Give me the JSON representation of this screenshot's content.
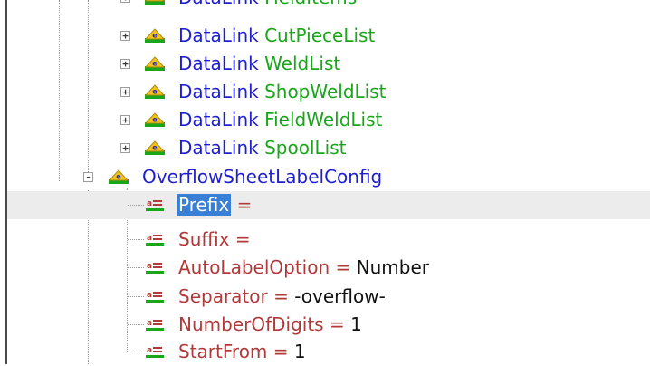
{
  "tree": {
    "datalinks": [
      {
        "keyword": "DataLink",
        "name": "FieldItems"
      },
      {
        "keyword": "DataLink",
        "name": "CutPieceList"
      },
      {
        "keyword": "DataLink",
        "name": "WeldList"
      },
      {
        "keyword": "DataLink",
        "name": "ShopWeldList"
      },
      {
        "keyword": "DataLink",
        "name": "FieldWeldList"
      },
      {
        "keyword": "DataLink",
        "name": "SpoolList"
      }
    ],
    "config_node": {
      "label": "OverflowSheetLabelConfig",
      "expander": "-"
    },
    "collapsed_expander": "+",
    "attributes": [
      {
        "name": "Prefix",
        "eq": "=",
        "value": ""
      },
      {
        "name": "Suffix",
        "eq": "=",
        "value": ""
      },
      {
        "name": "AutoLabelOption",
        "eq": "=",
        "value": "Number"
      },
      {
        "name": "Separator",
        "eq": "=",
        "value": "-overflow-"
      },
      {
        "name": "NumberOfDigits",
        "eq": "=",
        "value": "1"
      },
      {
        "name": "StartFrom",
        "eq": "=",
        "value": "1"
      }
    ],
    "selected_attribute": "Prefix"
  },
  "colors": {
    "element_keyword": "#1f1fd0",
    "element_name": "#1aa51a",
    "attribute_name": "#b03a3a",
    "attribute_value": "#111111",
    "selection": "#3a7fd6",
    "selected_row": "#ececec"
  },
  "icons": {
    "element": "element-node-icon",
    "attribute": "attribute-node-icon"
  }
}
